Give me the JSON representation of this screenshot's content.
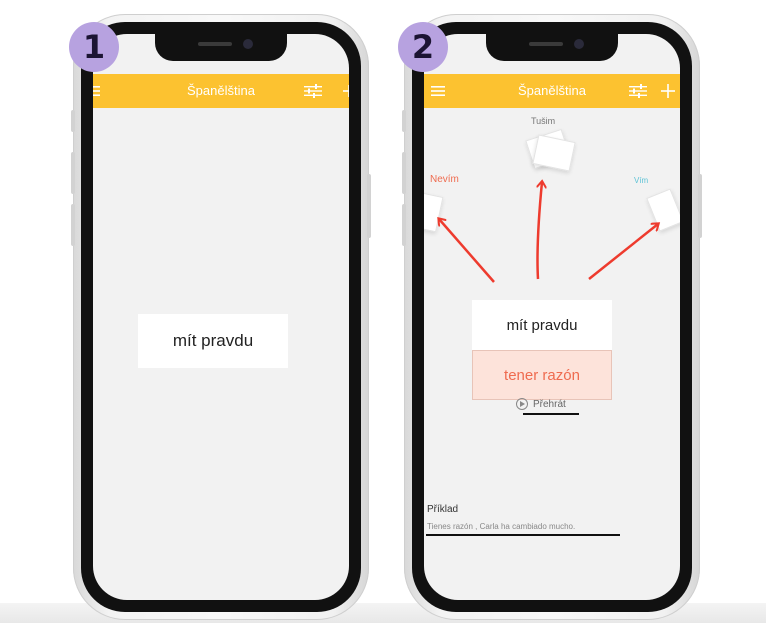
{
  "colors": {
    "accent": "#fcc230",
    "badge": "#b7a2e0",
    "arrow": "#ee3b2e",
    "dont_know": "#ef6b4f",
    "know": "#5ec3d6",
    "answer_bg": "#fde3da"
  },
  "icons": {
    "menu": "hamburger-icon",
    "filter": "sliders-icon",
    "add": "plus-icon",
    "play": "play-circle-icon"
  },
  "step1": {
    "badge": "1",
    "header_title": "Španělština",
    "card_front": "mít pravdu"
  },
  "step2": {
    "badge": "2",
    "header_title": "Španělština",
    "label_guess": "Tušim",
    "label_dont_know": "Nevím",
    "label_know": "Vím",
    "card_front": "mít pravdu",
    "card_back": "tener razón",
    "play_label": "Přehrát",
    "example_title": "Příklad",
    "example_sentence": "Tienes razón , Carla ha cambiado mucho."
  }
}
